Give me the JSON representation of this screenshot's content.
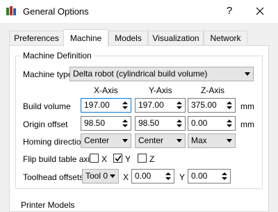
{
  "window": {
    "title": "General Options",
    "help_label": "?",
    "close_label": "✕"
  },
  "tabs": [
    {
      "label": "Preferences",
      "active": false
    },
    {
      "label": "Machine",
      "active": true
    },
    {
      "label": "Models",
      "active": false
    },
    {
      "label": "Visualization",
      "active": false
    },
    {
      "label": "Network",
      "active": false
    }
  ],
  "machine_definition": {
    "title": "Machine Definition",
    "machine_type": {
      "label": "Machine type",
      "value": "Delta robot (cylindrical build volume)"
    },
    "axis_headers": [
      "X-Axis",
      "Y-Axis",
      "Z-Axis"
    ],
    "build_volume": {
      "label": "Build volume",
      "x": "197.00",
      "y": "197.00",
      "z": "375.00",
      "unit": "mm"
    },
    "origin_offset": {
      "label": "Origin offset",
      "x": "98.50",
      "y": "98.50",
      "z": "0.00",
      "unit": "mm"
    },
    "homing_direction": {
      "label": "Homing direction",
      "x": "Center",
      "y": "Center",
      "z": "Max"
    },
    "flip_build_table": {
      "label": "Flip build table axis",
      "x": {
        "label": "X",
        "checked": false
      },
      "y": {
        "label": "Y",
        "checked": true
      },
      "z": {
        "label": "Z",
        "checked": false
      }
    },
    "toolhead_offsets": {
      "label": "Toolhead offsets",
      "tool": "Tool 0",
      "x_label": "X",
      "x": "0.00",
      "y_label": "Y",
      "y": "0.00"
    }
  },
  "next_section_title": "Printer Models",
  "colors": {
    "accent": "#0078d7",
    "border": "#adadad",
    "panel": "#ffffff",
    "background": "#f0f0f0"
  }
}
